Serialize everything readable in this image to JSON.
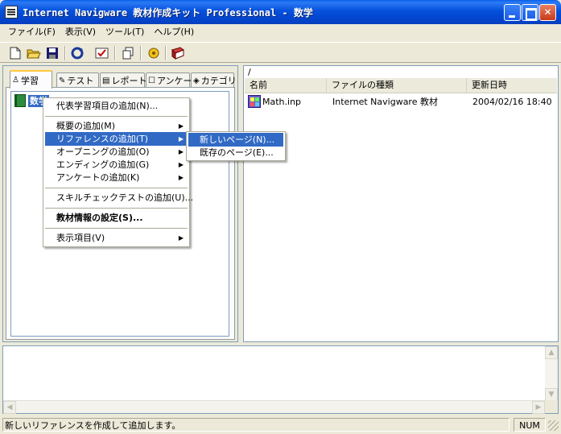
{
  "window": {
    "title": "Internet Navigware 教材作成キット Professional - 数学",
    "minimize": "",
    "maximize": "",
    "close": ""
  },
  "menubar": [
    "ファイル(F)",
    "表示(V)",
    "ツール(T)",
    "ヘルプ(H)"
  ],
  "toolbar": [
    "new-file",
    "open-folder",
    "save",
    "refresh",
    "check",
    "copy-window",
    "settings",
    "book"
  ],
  "tabs": [
    {
      "label": "学習",
      "icon": "person-icon",
      "active": true
    },
    {
      "label": "テスト",
      "icon": "pen-icon"
    },
    {
      "label": "レポート",
      "icon": "report-icon"
    },
    {
      "label": "アンケート",
      "icon": "survey-icon"
    },
    {
      "label": "カテゴリ",
      "icon": "category-icon"
    }
  ],
  "tree": {
    "root": "数学"
  },
  "context_menu": {
    "items": [
      {
        "label": "代表学習項目の追加(N)...",
        "submenu": false
      },
      {
        "label": "概要の追加(M)",
        "submenu": true
      },
      {
        "label": "リファレンスの追加(T)",
        "submenu": true,
        "highlighted": true
      },
      {
        "label": "オープニングの追加(O)",
        "submenu": true
      },
      {
        "label": "エンディングの追加(G)",
        "submenu": true
      },
      {
        "label": "アンケートの追加(K)",
        "submenu": true
      },
      {
        "label": "スキルチェックテストの追加(U)...",
        "submenu": false
      },
      {
        "label": "教材情報の設定(S)...",
        "submenu": false,
        "bold": true
      },
      {
        "label": "表示項目(V)",
        "submenu": true
      }
    ]
  },
  "submenu": {
    "items": [
      {
        "label": "新しいページ(N)...",
        "highlighted": true
      },
      {
        "label": "既存のページ(E)..."
      }
    ]
  },
  "listview": {
    "path": "/",
    "columns": [
      "名前",
      "ファイルの種類",
      "更新日時"
    ],
    "rows": [
      {
        "name": "Math.inp",
        "type": "Internet Navigware 教材",
        "modified": "2004/02/16 18:40"
      }
    ]
  },
  "statusbar": {
    "text": "新しいリファレンスを作成して追加します。",
    "num": "NUM"
  }
}
